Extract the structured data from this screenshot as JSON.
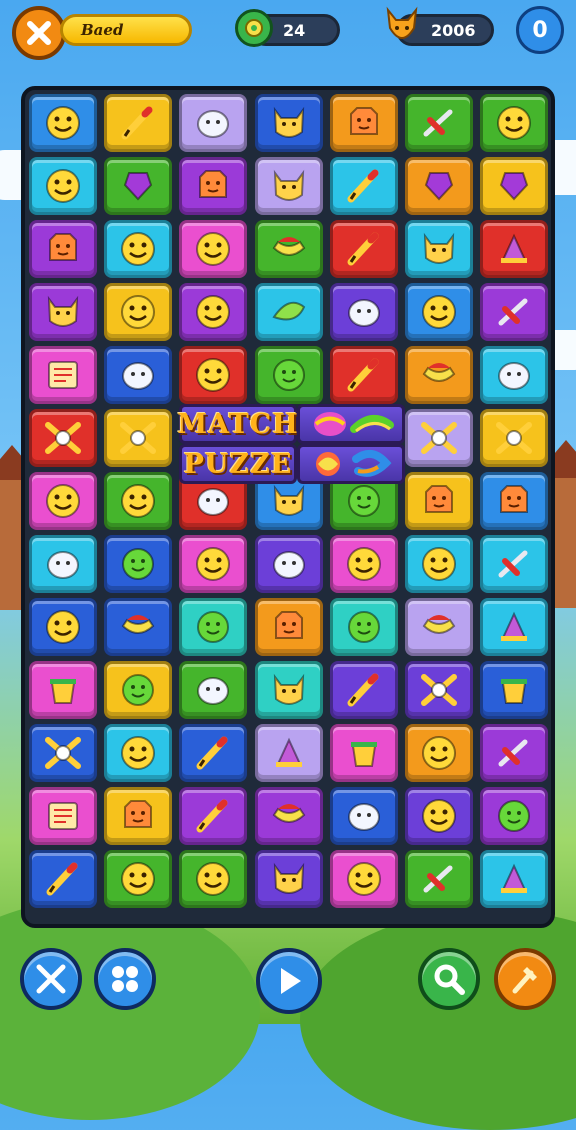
{
  "hud": {
    "player_name": "Baed",
    "gems": "24",
    "score": "2006",
    "level": "0"
  },
  "logo": {
    "line1": "MATCH",
    "line2": "PUZZE"
  },
  "colors": {
    "yellow": "#f6c21c",
    "blue": "#2f8ee8",
    "purple": "#9b3ad8",
    "green": "#45b52c",
    "orange": "#f39a1c",
    "red": "#e0302a",
    "cyan": "#2cc4e8",
    "pink": "#ea4fcf",
    "lavender": "#b9a3f0",
    "teal": "#2fd0c4",
    "violet": "#6c3fd8",
    "navy": "#2a5fd8"
  },
  "icons": [
    "smiley-icon",
    "pencil-icon",
    "blob-icon",
    "cat-icon",
    "bear-icon",
    "knife-icon",
    "leaf-icon",
    "cross-icon",
    "brush-icon",
    "bucket-icon",
    "hat-icon",
    "wand-icon",
    "swirl-icon",
    "note-icon"
  ],
  "bottom_bar": {
    "left1": "close-action",
    "left2": "grid-menu",
    "center": "play",
    "right1": "search",
    "right2": "hammer-tool"
  }
}
